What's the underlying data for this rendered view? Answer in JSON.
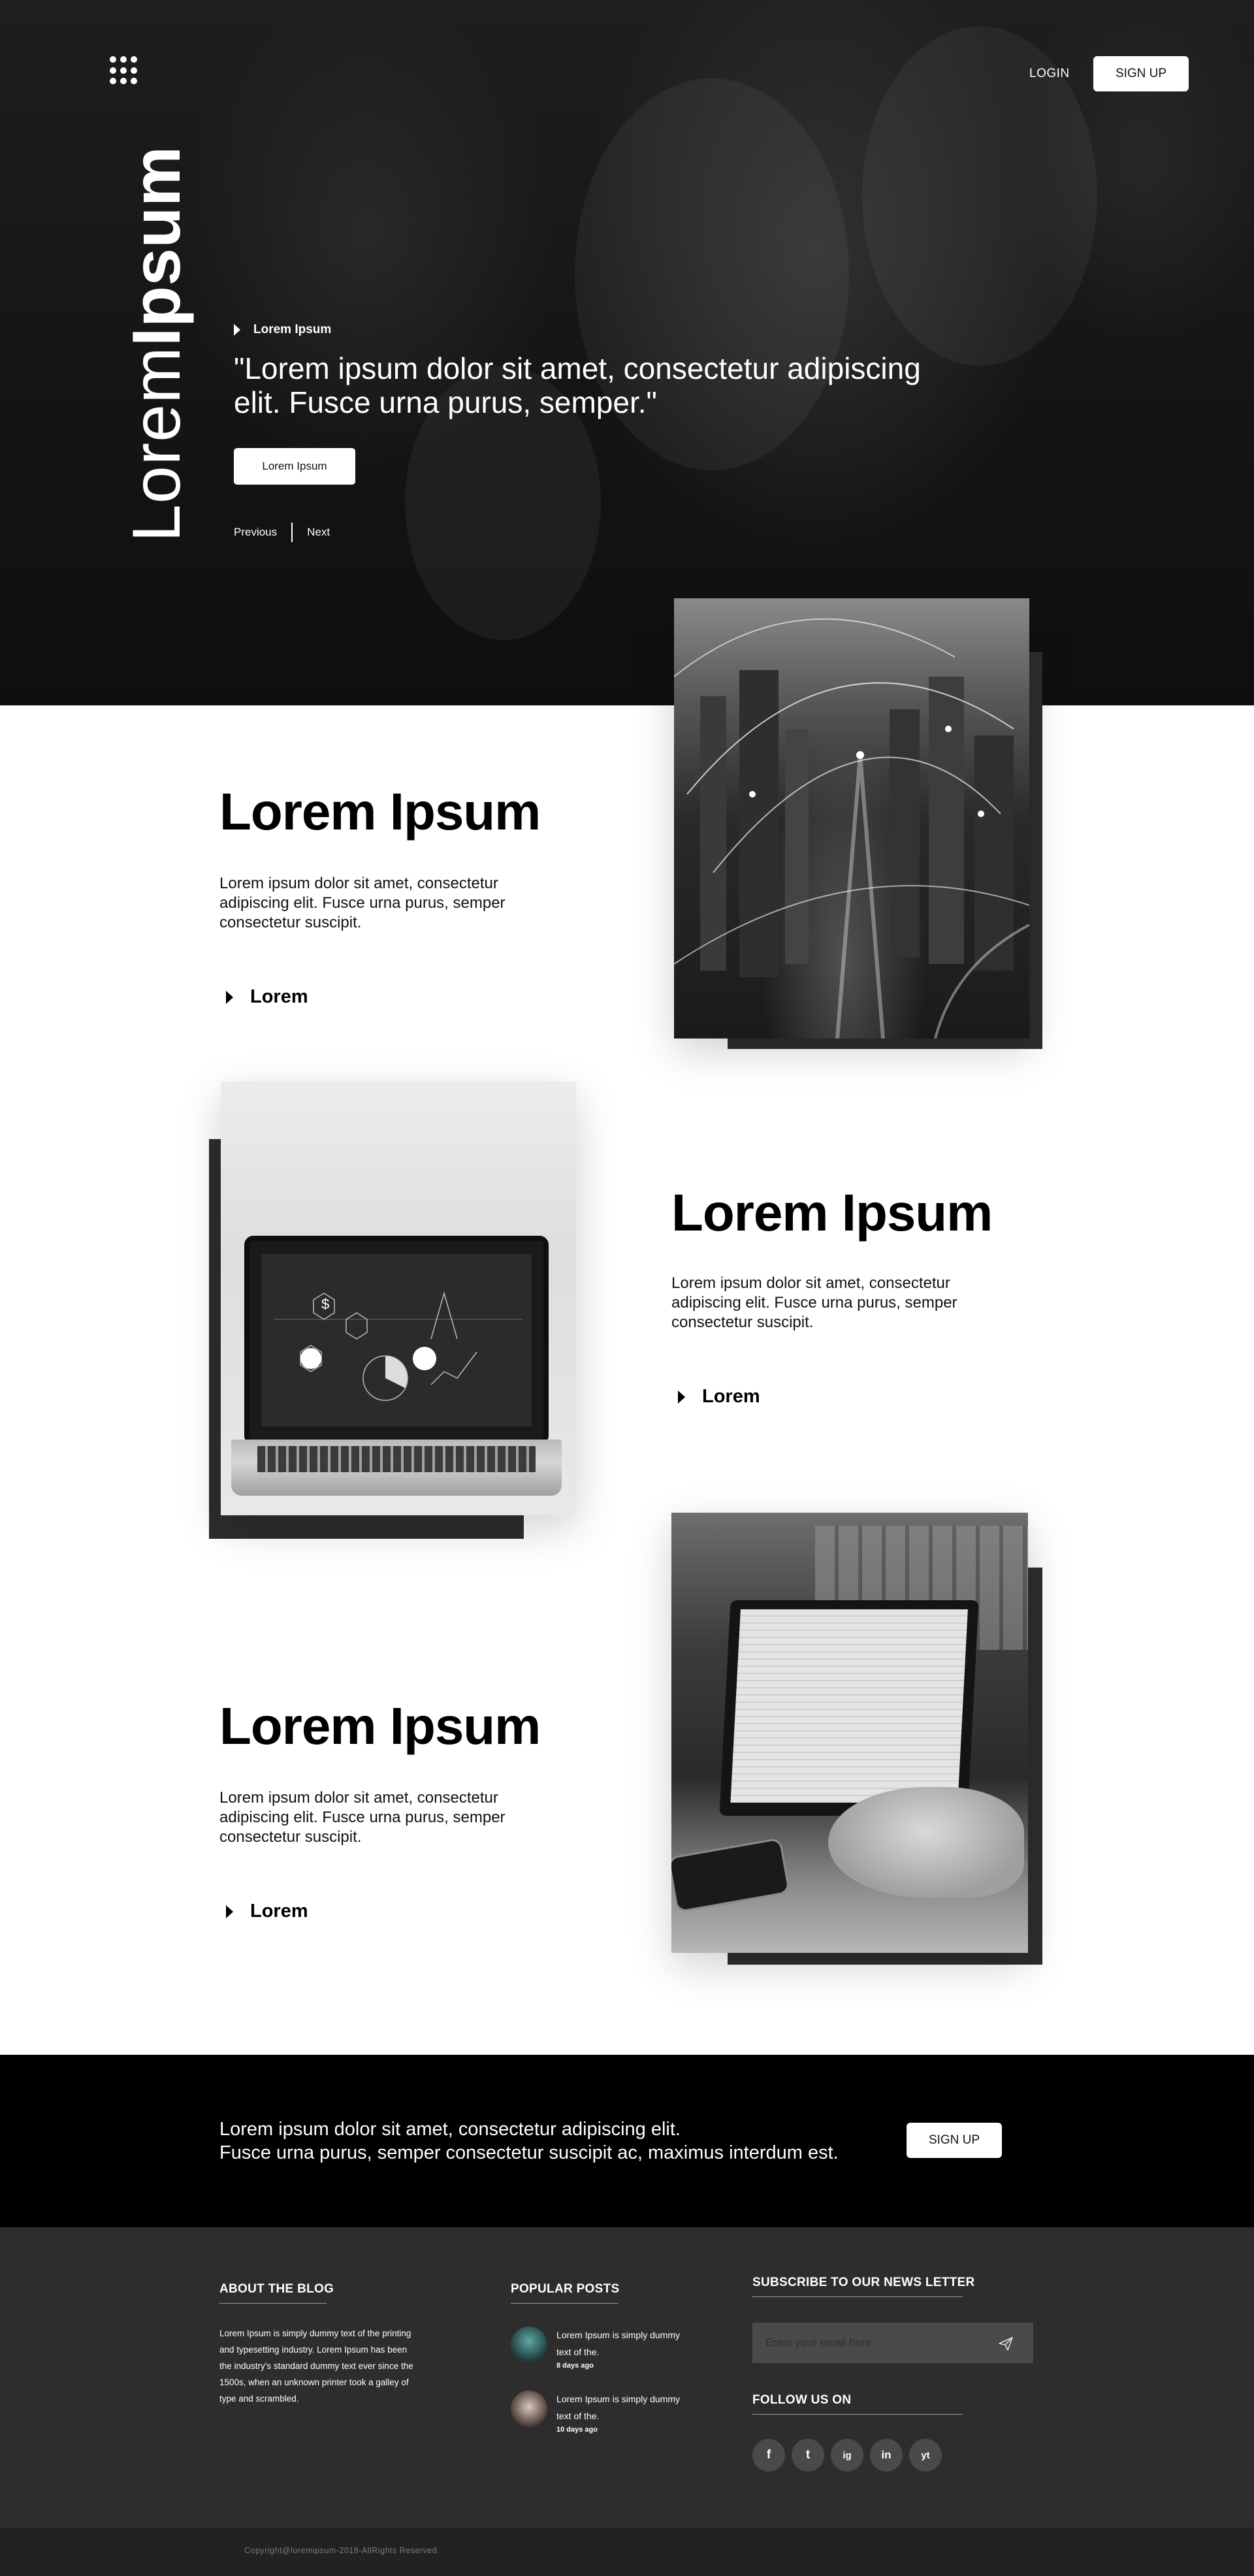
{
  "brand": {
    "light": "Lorem",
    "bold": "Ipsum"
  },
  "header": {
    "login": "LOGIN",
    "signup": "SIGN UP"
  },
  "hero": {
    "eyebrow": "Lorem Ipsum",
    "quote": "\"Lorem ipsum dolor sit amet, consectetur adipiscing elit. Fusce urna purus, semper.\"",
    "cta": "Lorem Ipsum",
    "prev": "Previous",
    "next": "Next"
  },
  "features": [
    {
      "title": "Lorem Ipsum",
      "text": "Lorem ipsum dolor sit amet, consectetur adipiscing elit. Fusce urna purus, semper consectetur suscipit.",
      "link": "Lorem"
    },
    {
      "title": "Lorem Ipsum",
      "text": "Lorem ipsum dolor sit amet, consectetur adipiscing elit. Fusce urna purus, semper consectetur suscipit.",
      "link": "Lorem"
    },
    {
      "title": "Lorem Ipsum",
      "text": "Lorem ipsum dolor sit amet, consectetur adipiscing elit. Fusce urna purus, semper consectetur suscipit.",
      "link": "Lorem"
    }
  ],
  "cta_band": {
    "line1": "Lorem ipsum dolor sit amet, consectetur adipiscing elit.",
    "line2": "Fusce urna purus, semper consectetur suscipit ac, maximus interdum est.",
    "button": "SIGN UP"
  },
  "footer": {
    "about_heading": "ABOUT THE BLOG",
    "about_text": "Lorem Ipsum is simply dummy text of the printing and typesetting industry. Lorem Ipsum has been the industry's standard dummy text ever since the 1500s, when an unknown printer took a galley of type and scrambled.",
    "popular_heading": "POPULAR POSTS",
    "posts": [
      {
        "title": "Lorem Ipsum is simply dummy text of the.",
        "date": "8 days ago"
      },
      {
        "title": "Lorem Ipsum is simply dummy text of the.",
        "date": "10 days ago"
      }
    ],
    "newsletter_heading": "SUBSCRIBE TO OUR NEWS LETTER",
    "email_placeholder": "Enter your email here",
    "follow_heading": "FOLLOW US ON",
    "socials": [
      "f",
      "t",
      "ig",
      "in",
      "yt"
    ],
    "copyright": "Copyright@loremipsum-2018-AllRights Reserved."
  },
  "icons": {
    "menu": "grid-menu-icon",
    "send": "paper-plane-icon",
    "social": [
      "facebook-icon",
      "twitter-icon",
      "instagram-icon",
      "linkedin-icon",
      "youtube-icon"
    ]
  },
  "colors": {
    "hero_bg": "#141414",
    "frame": "#2d2d2d",
    "cta_band": "#000000",
    "footer_bg": "#2d2d2d",
    "copyright_bg": "#222222",
    "social_bg": "#4a4a4a"
  }
}
